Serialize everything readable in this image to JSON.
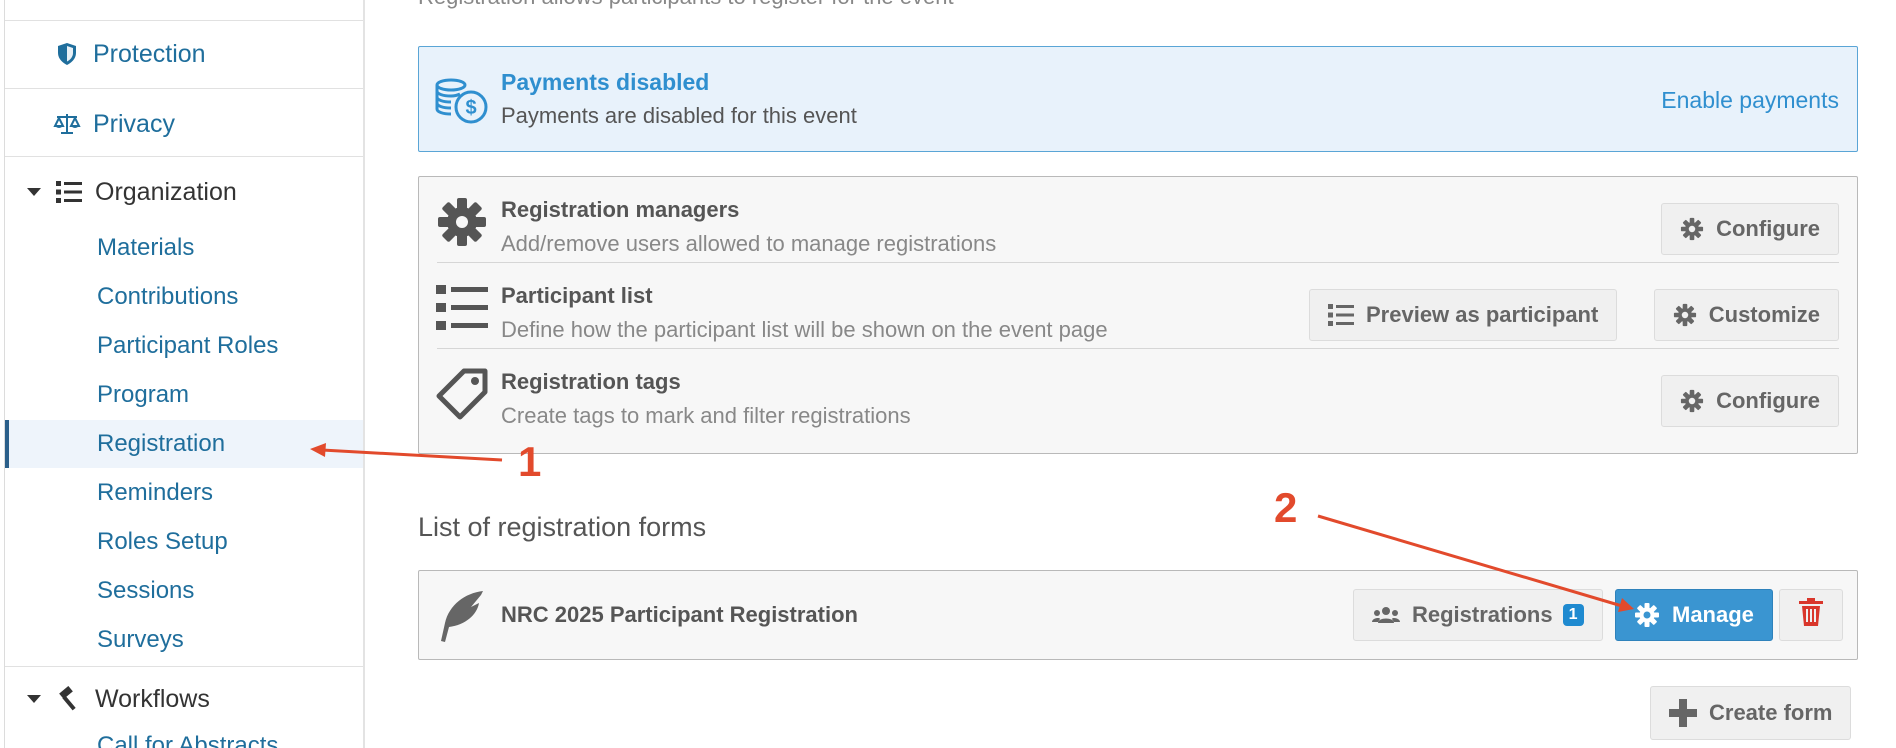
{
  "sidebar": {
    "protection": "Protection",
    "privacy": "Privacy",
    "organization": "Organization",
    "organization_items": [
      "Materials",
      "Contributions",
      "Participant Roles",
      "Program",
      "Registration",
      "Reminders",
      "Roles Setup",
      "Sessions",
      "Surveys"
    ],
    "workflows": "Workflows",
    "workflows_partial": "Call for Abstracts"
  },
  "main": {
    "faded_text": "Registration allows participants to register for the event",
    "alert": {
      "title": "Payments disabled",
      "description": "Payments are disabled for this event",
      "action": "Enable payments"
    },
    "rows": [
      {
        "title": "Registration managers",
        "description": "Add/remove users allowed to manage registrations",
        "buttons": [
          "Configure"
        ]
      },
      {
        "title": "Participant list",
        "description": "Define how the participant list will be shown on the event page",
        "buttons": [
          "Preview as participant",
          "Customize"
        ]
      },
      {
        "title": "Registration tags",
        "description": "Create tags to mark and filter registrations",
        "buttons": [
          "Configure"
        ]
      }
    ],
    "forms_title": "List of registration forms",
    "form": {
      "name": "NRC 2025 Participant Registration",
      "registrations_label": "Registrations",
      "registrations_count": "1",
      "manage_label": "Manage"
    },
    "create_form": "Create form"
  },
  "annotations": {
    "one": "1",
    "two": "2"
  },
  "colors": {
    "link": "#1f6e9c",
    "accent": "#3a95d1",
    "alert_bg": "#e8f2fb",
    "annotation": "#e24a2c",
    "danger": "#d9362b"
  }
}
